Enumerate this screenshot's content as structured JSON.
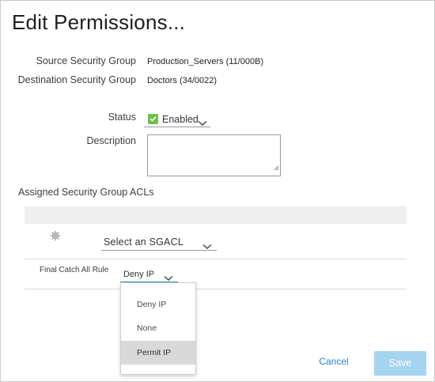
{
  "dialog": {
    "title": "Edit Permissions..."
  },
  "form": {
    "source_label": "Source Security Group",
    "source_value": "Production_Servers (11/000B)",
    "destination_label": "Destination Security Group",
    "destination_value": "Doctors (34/0022)",
    "status_label": "Status",
    "status_value": "Enabled",
    "description_label": "Description",
    "description_value": ""
  },
  "acls": {
    "section_label": "Assigned Security Group ACLs",
    "sgacl_placeholder": "Select an SGACL",
    "final_catch_label": "Final Catch All Rule",
    "final_catch_value": "Deny IP",
    "options": [
      "Deny IP",
      "None",
      "Permit IP"
    ],
    "highlighted_option": "Permit IP"
  },
  "footer": {
    "cancel_label": "Cancel",
    "save_label": "Save"
  },
  "colors": {
    "enabled_check": "#6cc04a",
    "link_blue": "#2b7fc4",
    "save_disabled": "#a5d4ef",
    "focus_underline": "#2b8fcd"
  },
  "icons": {
    "status_check": "check-icon",
    "row_settings": "gear-icon",
    "dropdown": "chevron-down-icon"
  }
}
